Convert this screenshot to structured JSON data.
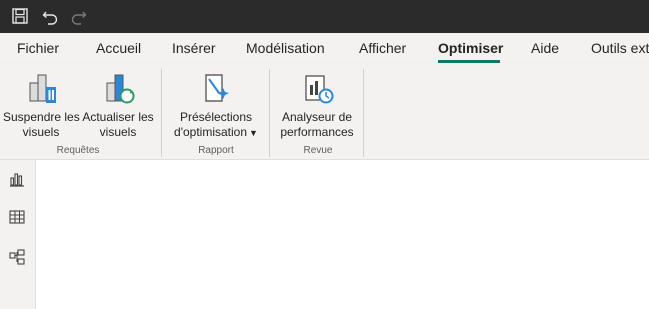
{
  "titlebar": {
    "icons": [
      "save-icon",
      "undo-icon",
      "redo-icon"
    ]
  },
  "tabs": [
    {
      "label": "Fichier"
    },
    {
      "label": "Accueil"
    },
    {
      "label": "Insérer"
    },
    {
      "label": "Modélisation"
    },
    {
      "label": "Afficher"
    },
    {
      "label": "Optimiser",
      "active": true
    },
    {
      "label": "Aide"
    },
    {
      "label": "Outils ext"
    }
  ],
  "ribbon": {
    "groups": [
      {
        "label": "Requêtes",
        "buttons": [
          {
            "line1": "Suspendre les",
            "line2": "visuels",
            "icon": "pause-visuals-icon"
          },
          {
            "line1": "Actualiser les",
            "line2": "visuels",
            "icon": "refresh-visuals-icon"
          }
        ]
      },
      {
        "label": "Rapport",
        "buttons": [
          {
            "line1": "Présélections",
            "line2": "d'optimisation",
            "icon": "optimization-presets-icon",
            "dropdown": true
          }
        ]
      },
      {
        "label": "Revue",
        "buttons": [
          {
            "line1": "Analyseur de",
            "line2": "performances",
            "icon": "performance-analyzer-icon"
          }
        ]
      }
    ]
  },
  "leftrail": {
    "icons": [
      "report-view-icon",
      "table-view-icon",
      "model-view-icon"
    ]
  },
  "colors": {
    "titlebar": "#2b2b2b",
    "ribbon": "#f3f2f1",
    "accent": "#117865",
    "iconBlue": "#2b88d8",
    "iconGreen": "#2e9b5a"
  }
}
